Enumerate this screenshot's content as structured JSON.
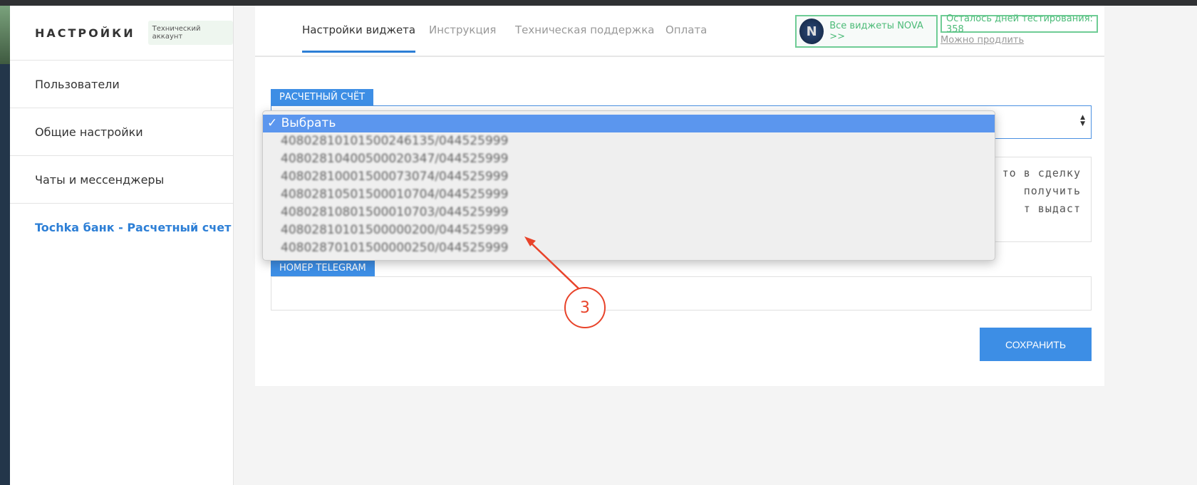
{
  "sidebar": {
    "title": "НАСТРОЙКИ",
    "badge": "Технический аккаунт",
    "items": [
      {
        "label": "Пользователи"
      },
      {
        "label": "Общие настройки"
      },
      {
        "label": "Чаты и мессенджеры"
      },
      {
        "label": "Tochka банк - Расчетный счет"
      }
    ]
  },
  "tabs": [
    {
      "label": "Настройки виджета"
    },
    {
      "label": "Инструкция"
    },
    {
      "label": "Техническая поддержка"
    },
    {
      "label": "Оплата"
    }
  ],
  "nova": {
    "logo": "N",
    "label": "Все виджеты NOVA >>"
  },
  "trial": {
    "text": "Осталось дней тестирования: 358",
    "extend": "Можно продлить"
  },
  "form": {
    "account_label": "РАСЧЕТНЫЙ СЧЁТ",
    "telegram_label": "НОМЕР TELEGRAM",
    "telegram_value": "",
    "textarea_lines": [
      "то в сделку",
      "получить",
      "т выдаст"
    ],
    "save": "СОХРАНИТЬ"
  },
  "dropdown": {
    "selected": "✓ Выбрать",
    "options": [
      "40802810101500246135/044525999",
      "40802810400500020347/044525999",
      "40802810001500073074/044525999",
      "40802810501500010704/044525999",
      "40802810801500010703/044525999",
      "40802810101500000200/044525999",
      "40802870101500000250/044525999"
    ]
  },
  "annotation": {
    "number": "3",
    "color": "#e8432a"
  }
}
